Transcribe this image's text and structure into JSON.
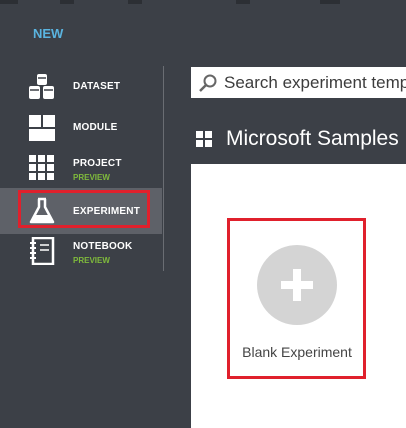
{
  "nav": {
    "new_label": "NEW",
    "items": [
      {
        "label": "DATASET",
        "icon": "dataset-icon"
      },
      {
        "label": "MODULE",
        "icon": "module-icon"
      },
      {
        "label": "PROJECT",
        "sub": "PREVIEW",
        "icon": "project-icon"
      },
      {
        "label": "EXPERIMENT",
        "icon": "experiment-icon",
        "selected": true
      },
      {
        "label": "NOTEBOOK",
        "sub": "PREVIEW",
        "icon": "notebook-icon"
      }
    ]
  },
  "search": {
    "placeholder": "Search experiment templ"
  },
  "samples": {
    "title": "Microsoft Samples",
    "blank_label": "Blank Experiment"
  },
  "colors": {
    "sidebar_bg": "#3c4047",
    "accent_blue": "#5ab4e0",
    "preview_green": "#7fba3c",
    "highlight_red": "#e0202c"
  }
}
